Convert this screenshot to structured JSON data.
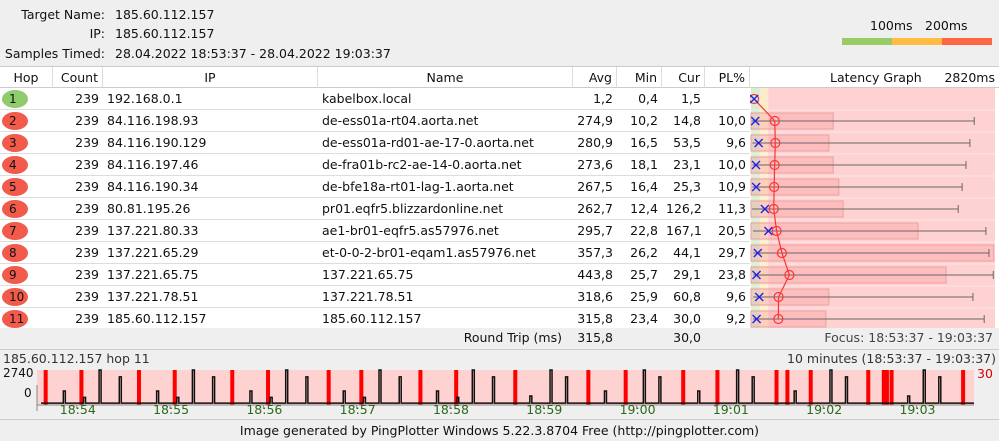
{
  "header": {
    "target_name_label": "Target Name:",
    "target_name": "185.60.112.157",
    "ip_label": "IP:",
    "ip": "185.60.112.157",
    "samples_label": "Samples Timed:",
    "samples": "28.04.2022 18:53:37 - 28.04.2022 19:03:37",
    "legend": {
      "label_100": "100ms",
      "label_200": "200ms",
      "colors": [
        "#99cc66",
        "#ffbb44",
        "#ff6644"
      ]
    }
  },
  "columns": {
    "hop": "Hop",
    "count": "Count",
    "ip": "IP",
    "name": "Name",
    "avg": "Avg",
    "min": "Min",
    "cur": "Cur",
    "pl": "PL%",
    "graph": "Latency Graph",
    "graph_max": "2820ms"
  },
  "graph_scale_ms": 2820,
  "colors": {
    "good": "#8fcc6e",
    "bad": "#f25b4b",
    "graph_bg": "#ffd2d2",
    "line": "#ff3333",
    "cur_mark": "#2222ee"
  },
  "hops": [
    {
      "hop": "1",
      "count": "239",
      "ip": "192.168.0.1",
      "name": "kabelbox.local",
      "avg": "1,2",
      "min": "0,4",
      "cur": "1,5",
      "pl": "",
      "status": "good",
      "avg_ms": 1.2,
      "min_ms": 0.4,
      "cur_ms": 1.5,
      "max_ms": null,
      "box_ms": null
    },
    {
      "hop": "2",
      "count": "239",
      "ip": "84.116.198.93",
      "name": "de-ess01a-rt04.aorta.net",
      "avg": "274,9",
      "min": "10,2",
      "cur": "14,8",
      "pl": "10,0",
      "status": "bad",
      "avg_ms": 274.9,
      "min_ms": 10.2,
      "cur_ms": 14.8,
      "max_ms": 2580,
      "box_ms": 950
    },
    {
      "hop": "3",
      "count": "239",
      "ip": "84.116.190.129",
      "name": "de-ess01a-rd01-ae-17-0.aorta.net",
      "avg": "280,9",
      "min": "16,5",
      "cur": "53,5",
      "pl": "9,6",
      "status": "bad",
      "avg_ms": 280.9,
      "min_ms": 16.5,
      "cur_ms": 53.5,
      "max_ms": 2530,
      "box_ms": 900
    },
    {
      "hop": "4",
      "count": "239",
      "ip": "84.116.197.46",
      "name": "de-fra01b-rc2-ae-14-0.aorta.net",
      "avg": "273,6",
      "min": "18,1",
      "cur": "23,1",
      "pl": "10,0",
      "status": "bad",
      "avg_ms": 273.6,
      "min_ms": 18.1,
      "cur_ms": 23.1,
      "max_ms": 2485,
      "box_ms": 950
    },
    {
      "hop": "5",
      "count": "239",
      "ip": "84.116.190.34",
      "name": "de-bfe18a-rt01-lag-1.aorta.net",
      "avg": "267,5",
      "min": "16,4",
      "cur": "25,3",
      "pl": "10,9",
      "status": "bad",
      "avg_ms": 267.5,
      "min_ms": 16.4,
      "cur_ms": 25.3,
      "max_ms": 2440,
      "box_ms": 1015
    },
    {
      "hop": "6",
      "count": "239",
      "ip": "80.81.195.26",
      "name": "pr01.eqfr5.blizzardonline.net",
      "avg": "262,7",
      "min": "12,4",
      "cur": "126,2",
      "pl": "11,3",
      "status": "bad",
      "avg_ms": 262.7,
      "min_ms": 12.4,
      "cur_ms": 126.2,
      "max_ms": 2395,
      "box_ms": 1065
    },
    {
      "hop": "7",
      "count": "239",
      "ip": "137.221.80.33",
      "name": "ae1-br01-eqfr5.as57976.net",
      "avg": "295,7",
      "min": "22,8",
      "cur": "167,1",
      "pl": "20,5",
      "status": "bad",
      "avg_ms": 295.7,
      "min_ms": 22.8,
      "cur_ms": 167.1,
      "max_ms": 2715,
      "box_ms": 1930
    },
    {
      "hop": "8",
      "count": "239",
      "ip": "137.221.65.29",
      "name": "et-0-0-2-br01-eqam1.as57976.net",
      "avg": "357,3",
      "min": "26,2",
      "cur": "44,1",
      "pl": "29,7",
      "status": "bad",
      "avg_ms": 357.3,
      "min_ms": 26.2,
      "cur_ms": 44.1,
      "max_ms": 2750,
      "box_ms": 2805
    },
    {
      "hop": "9",
      "count": "239",
      "ip": "137.221.65.75",
      "name": "137.221.65.75",
      "avg": "443,8",
      "min": "25,7",
      "cur": "29,1",
      "pl": "23,8",
      "status": "bad",
      "avg_ms": 443.8,
      "min_ms": 25.7,
      "cur_ms": 29.1,
      "max_ms": 2800,
      "box_ms": 2255
    },
    {
      "hop": "10",
      "count": "239",
      "ip": "137.221.78.51",
      "name": "137.221.78.51",
      "avg": "318,6",
      "min": "25,9",
      "cur": "60,8",
      "pl": "9,6",
      "status": "bad",
      "avg_ms": 318.6,
      "min_ms": 25.9,
      "cur_ms": 60.8,
      "max_ms": 2565,
      "box_ms": 900
    },
    {
      "hop": "11",
      "count": "239",
      "ip": "185.60.112.157",
      "name": "185.60.112.157",
      "avg": "315,8",
      "min": "23,4",
      "cur": "30,0",
      "pl": "9,2",
      "status": "bad",
      "avg_ms": 315.8,
      "min_ms": 23.4,
      "cur_ms": 30.0,
      "max_ms": 2695,
      "box_ms": 865
    }
  ],
  "round_trip": {
    "label": "Round Trip (ms)",
    "avg": "315,8",
    "cur": "30,0",
    "focus": "Focus: 18:53:37 - 19:03:37"
  },
  "history": {
    "title": "185.60.112.157 hop 11",
    "range_label": "10 minutes (18:53:37 - 19:03:37)",
    "y_max_label": "2740",
    "y_min_label": "0",
    "loss_axis_label": "30",
    "start": "18:53:37",
    "end": "19:03:37",
    "y_max_ms": 2740,
    "baseline_ms": 150,
    "x_ticks": [
      "18:54",
      "18:55",
      "18:56",
      "18:57",
      "18:58",
      "18:59",
      "19:00",
      "19:01",
      "19:02",
      "19:03"
    ],
    "loss_times": [
      "18:53:40",
      "18:54:03",
      "18:54:40",
      "18:55:03",
      "18:55:40",
      "18:56:03",
      "18:56:42",
      "18:57:03",
      "18:57:41",
      "18:58:04",
      "18:58:42",
      "18:59:29",
      "18:59:53",
      "19:00:30",
      "19:00:52",
      "19:01:30",
      "19:01:37",
      "19:01:52",
      "19:02:29",
      "19:02:39",
      "19:02:41",
      "19:02:44",
      "19:03:30"
    ],
    "spikes": [
      [
        "18:53:52",
        1100
      ],
      [
        "18:54:05",
        600
      ],
      [
        "18:54:15",
        2740
      ],
      [
        "18:54:28",
        2200
      ],
      [
        "18:54:52",
        1100
      ],
      [
        "18:55:05",
        600
      ],
      [
        "18:55:15",
        2740
      ],
      [
        "18:55:28",
        2200
      ],
      [
        "18:55:52",
        1100
      ],
      [
        "18:56:05",
        600
      ],
      [
        "18:56:15",
        2740
      ],
      [
        "18:56:28",
        2200
      ],
      [
        "18:56:52",
        1100
      ],
      [
        "18:57:05",
        600
      ],
      [
        "18:57:15",
        2740
      ],
      [
        "18:57:28",
        2200
      ],
      [
        "18:57:52",
        1100
      ],
      [
        "18:58:05",
        600
      ],
      [
        "18:58:15",
        2740
      ],
      [
        "18:58:28",
        2200
      ],
      [
        "18:58:52",
        700
      ],
      [
        "18:59:05",
        2740
      ],
      [
        "18:59:15",
        2200
      ],
      [
        "18:59:40",
        1100
      ],
      [
        "19:00:05",
        2740
      ],
      [
        "19:00:15",
        2200
      ],
      [
        "19:00:40",
        1100
      ],
      [
        "19:01:05",
        2740
      ],
      [
        "19:01:15",
        2200
      ],
      [
        "19:01:42",
        1100
      ],
      [
        "19:02:05",
        2740
      ],
      [
        "19:02:15",
        2200
      ],
      [
        "19:02:55",
        700
      ],
      [
        "19:03:05",
        2740
      ],
      [
        "19:03:15",
        2200
      ]
    ]
  },
  "footer": "Image generated by PingPlotter Windows 5.22.3.8704 Free (http://pingplotter.com)"
}
